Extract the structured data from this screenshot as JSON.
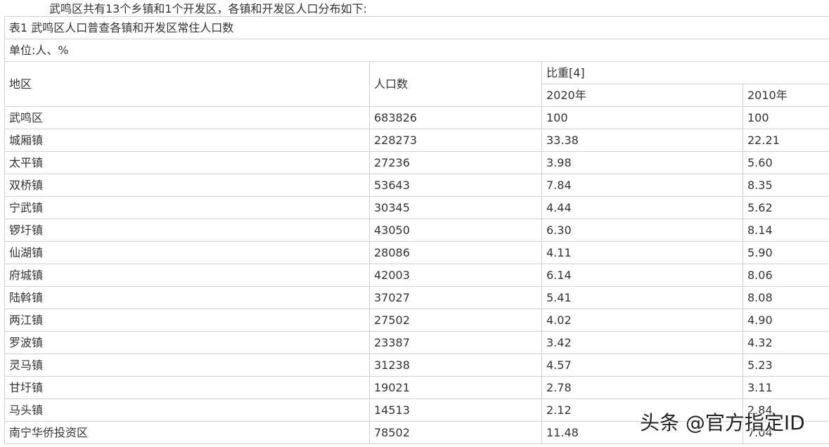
{
  "intro_text": "武鸣区共有13个乡镇和1个开发区，各镇和开发区人口分布如下:",
  "table": {
    "caption": "表1 武鸣区人口普查各镇和开发区常住人口数",
    "unit": "单位:人、%",
    "headers": {
      "region": "地区",
      "population": "人口数",
      "share": "比重[4]",
      "year_2020": "2020年",
      "year_2010": "2010年"
    },
    "rows": [
      {
        "region": "武鸣区",
        "population": "683826",
        "share_2020": "100",
        "share_2010": "100"
      },
      {
        "region": "城厢镇",
        "population": "228273",
        "share_2020": "33.38",
        "share_2010": "22.21"
      },
      {
        "region": "太平镇",
        "population": "27236",
        "share_2020": "3.98",
        "share_2010": "5.60"
      },
      {
        "region": "双桥镇",
        "population": "53643",
        "share_2020": "7.84",
        "share_2010": "8.35"
      },
      {
        "region": "宁武镇",
        "population": "30345",
        "share_2020": "4.44",
        "share_2010": "5.62"
      },
      {
        "region": "锣圩镇",
        "population": "43050",
        "share_2020": "6.30",
        "share_2010": "8.14"
      },
      {
        "region": "仙湖镇",
        "population": "28086",
        "share_2020": "4.11",
        "share_2010": "5.90"
      },
      {
        "region": "府城镇",
        "population": "42003",
        "share_2020": "6.14",
        "share_2010": "8.06"
      },
      {
        "region": "陆斡镇",
        "population": "37027",
        "share_2020": "5.41",
        "share_2010": "8.08"
      },
      {
        "region": "两江镇",
        "population": "27502",
        "share_2020": "4.02",
        "share_2010": "4.90"
      },
      {
        "region": "罗波镇",
        "population": "23387",
        "share_2020": "3.42",
        "share_2010": "4.32"
      },
      {
        "region": "灵马镇",
        "population": "31238",
        "share_2020": "4.57",
        "share_2010": "5.23"
      },
      {
        "region": "甘圩镇",
        "population": "19021",
        "share_2020": "2.78",
        "share_2010": "3.11"
      },
      {
        "region": "马头镇",
        "population": "14513",
        "share_2020": "2.12",
        "share_2010": "2.84"
      },
      {
        "region": "南宁华侨投资区",
        "population": "78502",
        "share_2020": "11.48",
        "share_2010": "7.04"
      }
    ]
  },
  "watermark": "头条 @官方指定ID"
}
